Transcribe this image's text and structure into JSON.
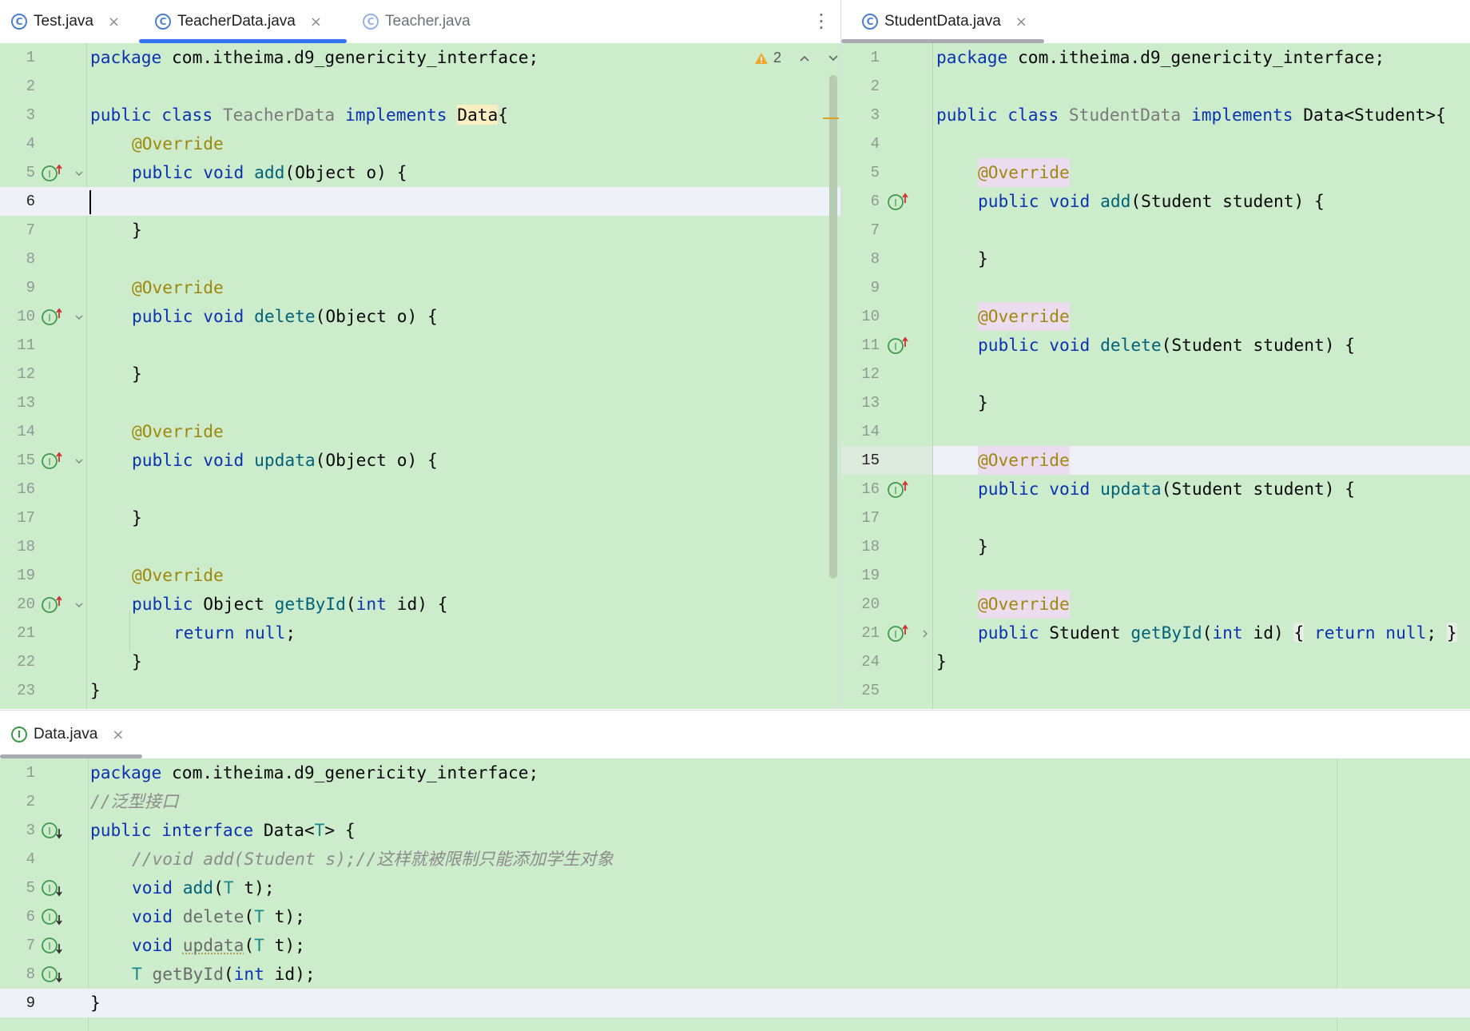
{
  "colors": {
    "editor_bg": "#cdeccb",
    "accent_tab": "#3574f0",
    "keyword": "#0a33b3",
    "annotation": "#9e880d",
    "method": "#00627a"
  },
  "icons": {
    "class_file": "c-circle-icon",
    "interface_file": "i-circle-icon",
    "implements_marker": "implements-gutter-icon",
    "implemented_marker": "implemented-gutter-icon"
  },
  "left": {
    "tabs": [
      {
        "label": "Test.java",
        "close": "×"
      },
      {
        "label": "TeacherData.java",
        "close": "×"
      },
      {
        "label": "Teacher.java"
      }
    ],
    "warning_count": "2",
    "lines": {
      "1": {
        "n": "1",
        "t0": "package",
        "t1": " com.itheima.d9_genericity_interface;"
      },
      "2": {
        "n": "2"
      },
      "3": {
        "n": "3",
        "t0": "public class",
        "t1": "TeacherData",
        "t2": "implements",
        "t3": "Data",
        "t4": "{"
      },
      "4": {
        "n": "4",
        "t0": "@Override"
      },
      "5": {
        "n": "5",
        "t0": "public void",
        "t1": "add",
        "t2": "(Object o) {"
      },
      "6": {
        "n": "6"
      },
      "7": {
        "n": "7",
        "t0": "}"
      },
      "8": {
        "n": "8"
      },
      "9": {
        "n": "9",
        "t0": "@Override"
      },
      "10": {
        "n": "10",
        "t0": "public void",
        "t1": "delete",
        "t2": "(Object o) {"
      },
      "11": {
        "n": "11"
      },
      "12": {
        "n": "12",
        "t0": "}"
      },
      "13": {
        "n": "13"
      },
      "14": {
        "n": "14",
        "t0": "@Override"
      },
      "15": {
        "n": "15",
        "t0": "public void",
        "t1": "updata",
        "t2": "(Object o) {"
      },
      "16": {
        "n": "16"
      },
      "17": {
        "n": "17",
        "t0": "}"
      },
      "18": {
        "n": "18"
      },
      "19": {
        "n": "19",
        "t0": "@Override"
      },
      "20": {
        "n": "20",
        "t0": "public",
        "t1": " Object ",
        "t2": "getById",
        "t3": "(",
        "t4": "int",
        "t5": " id) {"
      },
      "21": {
        "n": "21",
        "t0": "return null",
        "t1": ";"
      },
      "22": {
        "n": "22",
        "t0": "}"
      },
      "23": {
        "n": "23",
        "t0": "}"
      }
    }
  },
  "right": {
    "tabs": [
      {
        "label": "StudentData.java",
        "close": "×"
      }
    ],
    "lines": {
      "1": {
        "n": "1",
        "t0": "package",
        "t1": " com.itheima.d9_genericity_interface;"
      },
      "2": {
        "n": "2"
      },
      "3": {
        "n": "3",
        "t0": "public class",
        "t1": "StudentData",
        "t2": "implements",
        "t3": " Data<Student>{"
      },
      "4": {
        "n": "4"
      },
      "5": {
        "n": "5",
        "t0": "@Override"
      },
      "6": {
        "n": "6",
        "t0": "public void",
        "t1": "add",
        "t2": "(Student student) {"
      },
      "7": {
        "n": "7"
      },
      "8": {
        "n": "8",
        "t0": "}"
      },
      "9": {
        "n": "9"
      },
      "10": {
        "n": "10",
        "t0": "@Override"
      },
      "11": {
        "n": "11",
        "t0": "public void",
        "t1": "delete",
        "t2": "(Student student) {"
      },
      "12": {
        "n": "12"
      },
      "13": {
        "n": "13",
        "t0": "}"
      },
      "14": {
        "n": "14"
      },
      "15": {
        "n": "15",
        "t0": "@Override"
      },
      "16": {
        "n": "16",
        "t0": "public void",
        "t1": "updata",
        "t2": "(Student student) {"
      },
      "17": {
        "n": "17"
      },
      "18": {
        "n": "18",
        "t0": "}"
      },
      "19": {
        "n": "19"
      },
      "20": {
        "n": "20",
        "t0": "@Override"
      },
      "21": {
        "n": "21",
        "t0": "public",
        "t1": " Student ",
        "t2": "getById",
        "t3": "(",
        "t4": "int",
        "t5": " id) ",
        "t6": "{",
        "t7": "return null",
        "t8": "; ",
        "t9": "}"
      },
      "24": {
        "n": "24",
        "t0": "}"
      },
      "25": {
        "n": "25"
      }
    }
  },
  "bottom": {
    "tabs": [
      {
        "label": "Data.java",
        "close": "×"
      }
    ],
    "lines": {
      "1": {
        "n": "1",
        "t0": "package",
        "t1": " com.itheima.d9_genericity_interface;"
      },
      "2": {
        "n": "2",
        "t0": "//泛型接口"
      },
      "3": {
        "n": "3",
        "t0": "public interface",
        "t1": " Data<",
        "t2": "T",
        "t3": "> {"
      },
      "4": {
        "n": "4",
        "t0": "//void add(Student s);//这样就被限制只能添加学生对象"
      },
      "5": {
        "n": "5",
        "t0": "void",
        "t1": "add",
        "t2": "(",
        "t3": "T",
        "t4": " t);"
      },
      "6": {
        "n": "6",
        "t0": "void",
        "t1": "delete",
        "t2": "(",
        "t3": "T",
        "t4": " t);"
      },
      "7": {
        "n": "7",
        "t0": "void",
        "t1": "updata",
        "t2": "(",
        "t3": "T",
        "t4": " t);"
      },
      "8": {
        "n": "8",
        "t0": "T",
        "t1": "getById",
        "t2": "(",
        "t3": "int",
        "t4": " id);"
      },
      "9": {
        "n": "9",
        "t0": "}"
      }
    }
  }
}
